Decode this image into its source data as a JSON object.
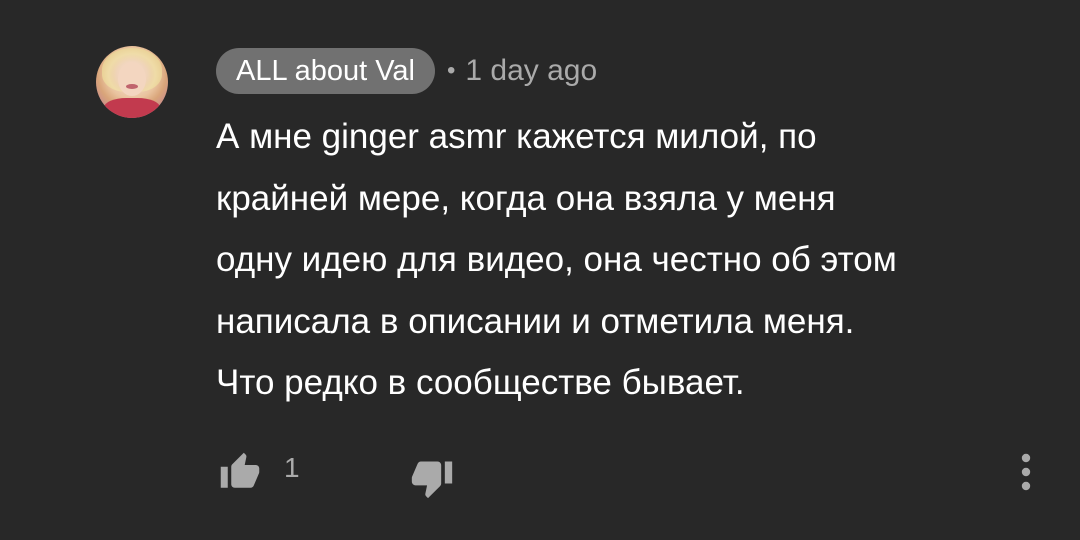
{
  "comment": {
    "author": "ALL about Val",
    "separator": "•",
    "timestamp": "1 day ago",
    "text": "А мне ginger asmr кажется милой, по\nкрайней мере, когда она взяла у меня\nодну идею для видео, она честно об этом\nнаписала в описании и отметила меня.\nЧто редко в сообществе бывает.",
    "like_count": "1"
  },
  "icons": {
    "like": "thumbs-up-icon",
    "dislike": "thumbs-down-icon",
    "more": "more-vertical-icon"
  },
  "colors": {
    "background": "#282828",
    "author_chip": "#717171",
    "secondary_text": "#aaaaaa",
    "primary_text": "#ffffff"
  }
}
